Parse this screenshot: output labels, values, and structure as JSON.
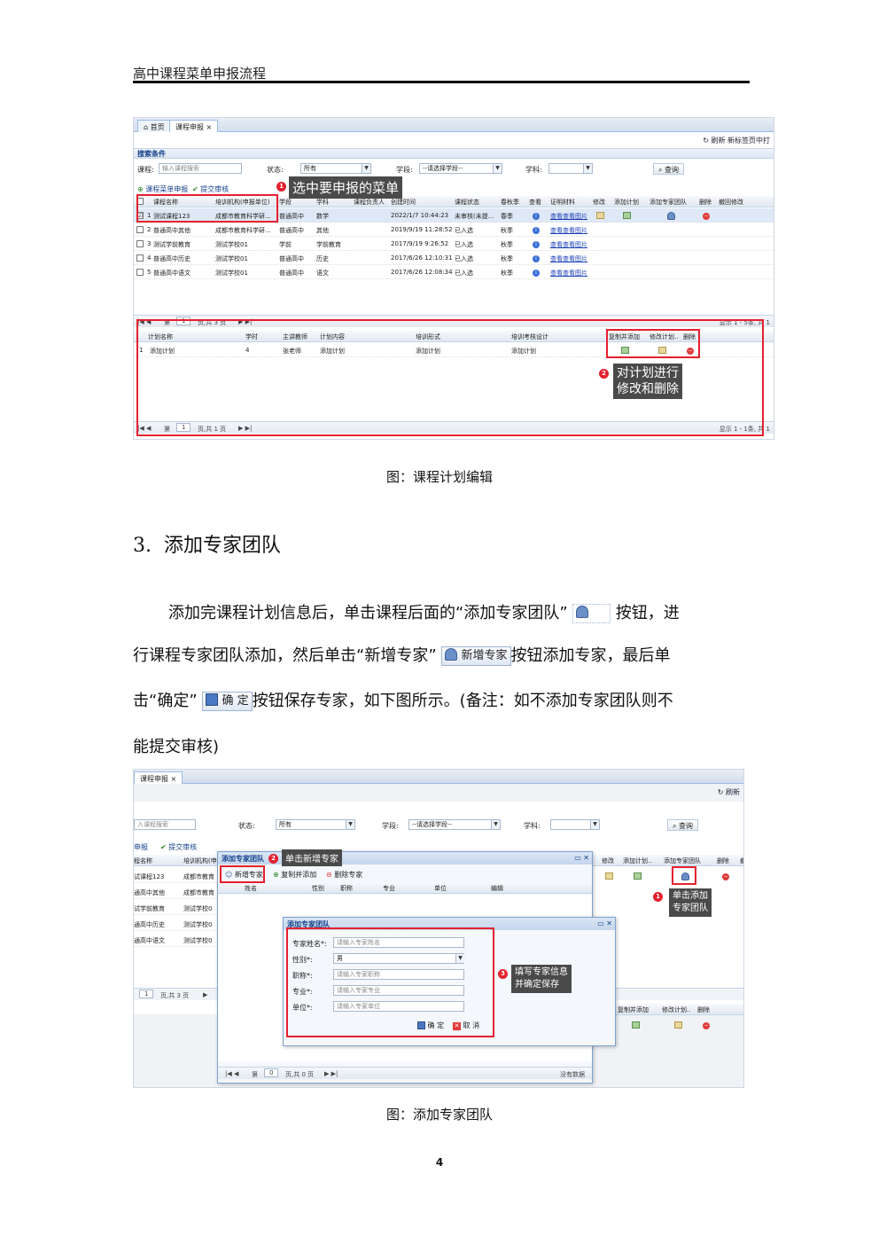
{
  "header": {
    "title": "高中课程菜单申报流程"
  },
  "shot1": {
    "tabs": [
      "首页",
      "课程申报"
    ],
    "toolbar_right": "刷新  新标签页中打",
    "search_strip": "搜索条件",
    "search": {
      "course_label": "课程:",
      "course_placeholder": "输入课程搜索",
      "status_label": "状态:",
      "status_value": "所有",
      "stage_label": "学段:",
      "stage_value": "--请选择学段--",
      "subject_label": "学科:",
      "query_button": "查询"
    },
    "actions": {
      "new": "课程菜单申报",
      "submit": "提交审核"
    },
    "grid_headers": [
      "课程名称",
      "培训机构(申报单位)",
      "学段",
      "学科",
      "课程负责人",
      "创建时间",
      "课程状态",
      "春秋季",
      "查看",
      "证明材料",
      "修改",
      "添加计划",
      "添加专家团队",
      "删除",
      "撤回修改"
    ],
    "rows": [
      {
        "n": "1",
        "name": "测试课程123",
        "org": "成都市教育科学研...",
        "stage": "普通高中",
        "subject": "数学",
        "time": "2022/1/7 10:44:23",
        "status": "未审核(未提...",
        "season": "春季",
        "proof": "查看查看图片",
        "checked": "☑"
      },
      {
        "n": "2",
        "name": "普通高中其他",
        "org": "成都市教育科学研...",
        "stage": "普通高中",
        "subject": "其他",
        "time": "2019/9/19 11:28:52",
        "status": "已入选",
        "season": "秋季",
        "proof": "查看查看图片",
        "checked": ""
      },
      {
        "n": "3",
        "name": "测试学前教育",
        "org": "测试学校01",
        "stage": "学前",
        "subject": "学前教育",
        "time": "2017/9/19 9:26:52",
        "status": "已入选",
        "season": "秋季",
        "proof": "查看查看图片",
        "checked": ""
      },
      {
        "n": "4",
        "name": "普通高中历史",
        "org": "测试学校01",
        "stage": "普通高中",
        "subject": "历史",
        "time": "2017/6/26 12:10:31",
        "status": "已入选",
        "season": "秋季",
        "proof": "查看查看图片",
        "checked": ""
      },
      {
        "n": "5",
        "name": "普通高中语文",
        "org": "测试学校01",
        "stage": "普通高中",
        "subject": "语文",
        "time": "2017/6/26 12:08:34",
        "status": "已入选",
        "season": "秋季",
        "proof": "查看查看图片",
        "checked": ""
      }
    ],
    "pager1": {
      "first": "第",
      "page": "1",
      "of": "页,共 3 页",
      "display": "显示 1 - 5条, 共 1"
    },
    "plan_headers": [
      "计划名称",
      "学时",
      "主讲教师",
      "计划内容",
      "培训形式",
      "培训考核设计",
      "复制并添加",
      "修改计划..",
      "删除"
    ],
    "plan_row": {
      "n": "1",
      "name": "添加计划",
      "hours": "4",
      "teacher": "张老师",
      "content": "添加计划",
      "form": "添加计划",
      "design": "添加计划"
    },
    "pager2": {
      "first": "第",
      "page": "1",
      "of": "页,共 1 页",
      "display": "显示 1 - 1条, 共 1"
    },
    "callout1": "选中要申报的菜单",
    "callout2_line1": "对计划进行",
    "callout2_line2": "修改和删除",
    "badge1": "1",
    "badge2": "2"
  },
  "caption1": "图：课程计划编辑",
  "section": {
    "number": "3.",
    "title": "添加专家团队"
  },
  "paragraph": {
    "l1a": "添加完课程计划信息后，单击课程后面的“添加专家团队”",
    "l1b": "按钮，进",
    "l2a": "行课程专家团队添加，然后单击“新增专家”",
    "new_expert_btn": "新增专家",
    "l2b": "按钮添加专家，最后单",
    "l3a": "击“确定”",
    "confirm_btn": "确 定",
    "l3b": "按钮保存专家，如下图所示。(备注：如不添加专家团队则不",
    "l4": "能提交审核)"
  },
  "shot2": {
    "tab": "课程申报",
    "refresh": "刷新",
    "course_placeholder": "入课程搜索",
    "status_label": "状态:",
    "status_value": "所有",
    "stage_label": "学段:",
    "stage_value": "--请选择学段--",
    "subject_label": "学科:",
    "query": "查询",
    "actions": {
      "new": "申报",
      "submit": "提交审核"
    },
    "left_headers": [
      "程名称",
      "培训机构(申"
    ],
    "left_rows": [
      {
        "a": "试课程123",
        "b": "成都市教育"
      },
      {
        "a": "通高中其他",
        "b": "成都市教育"
      },
      {
        "a": "试学前教育",
        "b": "测试学校0"
      },
      {
        "a": "通高中历史",
        "b": "测试学校0"
      },
      {
        "a": "通高中语文",
        "b": "测试学校0"
      }
    ],
    "right_headers": [
      "修改",
      "添加计划..",
      "添加专家团队",
      "删除",
      "撤"
    ],
    "lower_headers": [
      "复制并添加",
      "修改计划..",
      "删除"
    ],
    "left_pager": "页,共 3 页",
    "left_pager_page": "1",
    "win1": {
      "title": "添加专家团队",
      "new_expert": "新增专家",
      "copy_add": "复制并添加",
      "delete_expert": "删除专家",
      "headers": [
        "姓名",
        "性别",
        "职称",
        "专业",
        "单位",
        "编辑"
      ],
      "pager": {
        "first": "第",
        "page": "0",
        "of": "页,共 0 页",
        "empty": "没有数据"
      }
    },
    "win2": {
      "title": "添加专家团队",
      "fields": [
        {
          "label": "专家姓名*:",
          "placeholder": "请输入专家姓名"
        },
        {
          "label": "性别*:",
          "placeholder": "男"
        },
        {
          "label": "职称*:",
          "placeholder": "请输入专家职称"
        },
        {
          "label": "专业*:",
          "placeholder": "请输入专家专业"
        },
        {
          "label": "单位*:",
          "placeholder": "请输入专家单位"
        }
      ],
      "ok": "确 定",
      "cancel": "取 消"
    },
    "callout1_line1": "单击添加",
    "callout1_line2": "专家团队",
    "callout2": "单击新增专家",
    "callout3_line1": "填写专家信息",
    "callout3_line2": "并确定保存",
    "badge1": "1",
    "badge2": "2",
    "badge3": "3"
  },
  "caption2": "图：添加专家团队",
  "page_number": "4"
}
